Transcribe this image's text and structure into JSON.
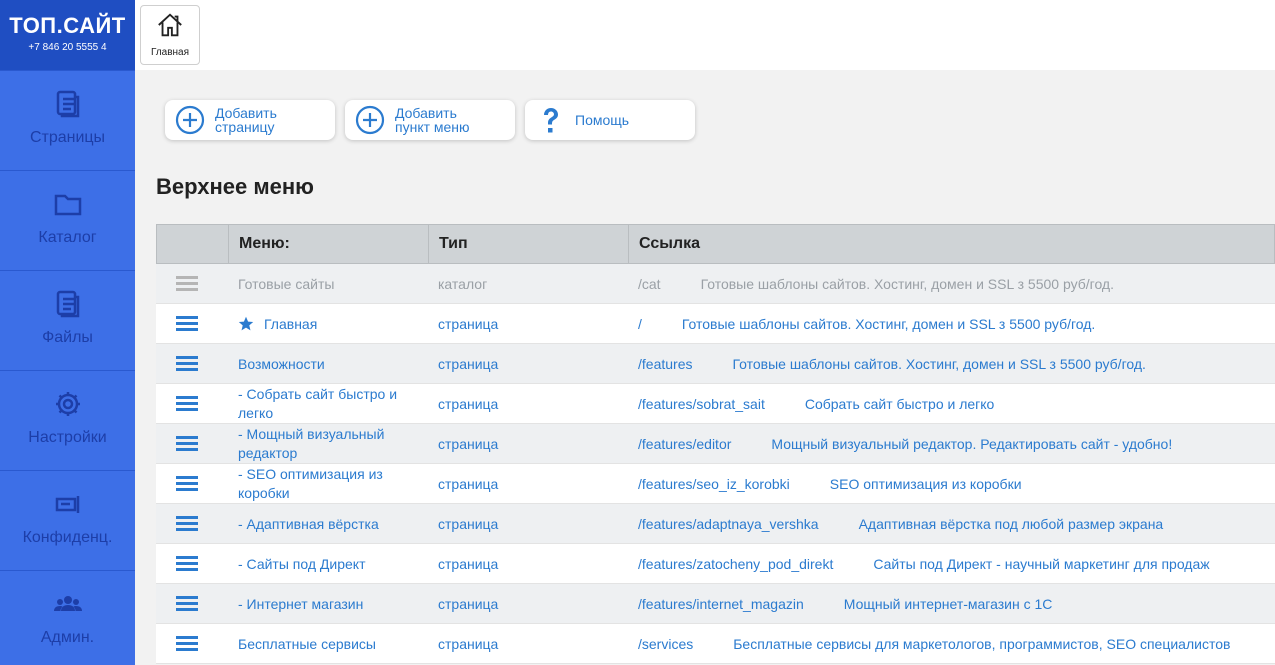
{
  "logo": {
    "title": "ТОП.САЙТ",
    "phone": "+7 846 20 5555 4"
  },
  "sidebar": {
    "items": [
      {
        "label": "Страницы",
        "icon": "pages-icon"
      },
      {
        "label": "Каталог",
        "icon": "folder-icon"
      },
      {
        "label": "Файлы",
        "icon": "files-icon"
      },
      {
        "label": "Настройки",
        "icon": "gear-icon"
      },
      {
        "label": "Конфиденц.",
        "icon": "privacy-icon"
      },
      {
        "label": "Админ.",
        "icon": "users-icon"
      }
    ]
  },
  "topbar": {
    "home_label": "Главная"
  },
  "actions": {
    "add_page": {
      "line1": "Добавить",
      "line2": "страницу"
    },
    "add_menu_item": {
      "line1": "Добавить",
      "line2": "пункт меню"
    },
    "help": "Помощь"
  },
  "section_title": "Верхнее меню",
  "table": {
    "headers": [
      "Меню:",
      "Тип",
      "Ссылка"
    ],
    "rows": [
      {
        "name": "Готовые сайты",
        "type": "каталог",
        "link": "/cat",
        "desc": "Готовые шаблоны сайтов. Хостинг, домен и SSL з 5500 руб/год."
      },
      {
        "name": "Главная",
        "type": "страница",
        "link": "/",
        "desc": "Готовые шаблоны сайтов. Хостинг, домен и SSL з 5500 руб/год."
      },
      {
        "name": "Возможности",
        "type": "страница",
        "link": "/features",
        "desc": "Готовые шаблоны сайтов. Хостинг, домен и SSL з 5500 руб/год."
      },
      {
        "name": " - Собрать сайт быстро и легко",
        "type": "страница",
        "link": "/features/sobrat_sait",
        "desc": "Собрать сайт быстро и легко"
      },
      {
        "name": " - Мощный визуальный редактор",
        "type": "страница",
        "link": "/features/editor",
        "desc": "Мощный визуальный редактор. Редактировать сайт - удобно!"
      },
      {
        "name": " - SEO оптимизация из коробки",
        "type": "страница",
        "link": "/features/seo_iz_korobki",
        "desc": "SEO оптимизация из коробки"
      },
      {
        "name": " - Адаптивная вёрстка",
        "type": "страница",
        "link": "/features/adaptnaya_vershka",
        "desc": "Адаптивная вёрстка под любой размер экрана"
      },
      {
        "name": " - Сайты под Директ",
        "type": "страница",
        "link": "/features/zatocheny_pod_direkt",
        "desc": "Сайты под Директ - научный маркетинг для продаж"
      },
      {
        "name": " - Интернет магазин",
        "type": "страница",
        "link": "/features/internet_magazin",
        "desc": "Мощный интернет-магазин с 1С"
      },
      {
        "name": "Бесплатные сервисы",
        "type": "страница",
        "link": "/services",
        "desc": "Бесплатные сервисы для маркетологов, программистов, SEO специалистов"
      }
    ]
  },
  "colors": {
    "sidebar": "#3d6fe7",
    "logo_bg": "#1f4ec2",
    "accent": "#2b7bcf",
    "header_bg": "#cfd3d6"
  }
}
